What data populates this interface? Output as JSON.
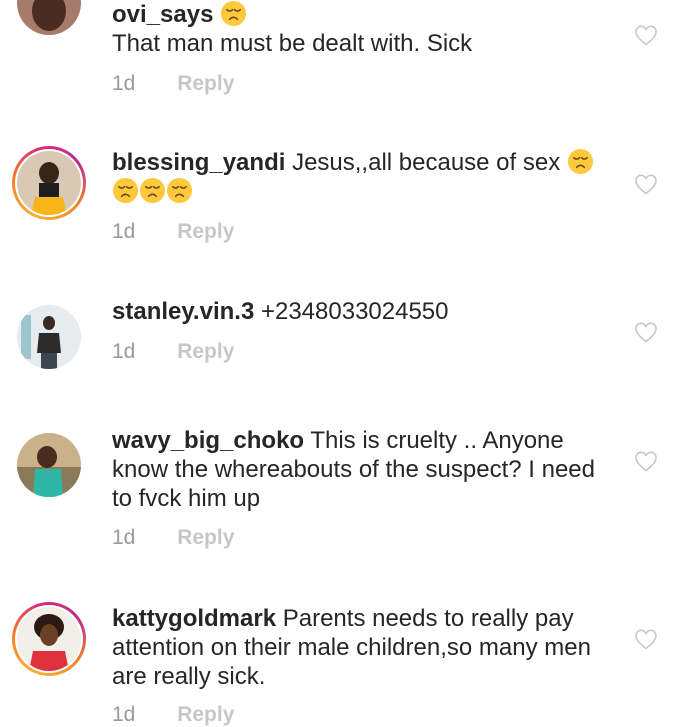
{
  "comments": [
    {
      "username": "ovi_says",
      "text": "That man must be dealt with. Sick",
      "time": "1d",
      "reply_label": "Reply",
      "emoji": "disappointed-face",
      "story_ring": false
    },
    {
      "username": "blessing_yandi",
      "text": "Jesus,,all because of sex",
      "time": "1d",
      "reply_label": "Reply",
      "emoji": "disappointed-face",
      "story_ring": true
    },
    {
      "username": "stanley.vin.3",
      "text": "+2348033024550",
      "time": "1d",
      "reply_label": "Reply",
      "story_ring": false
    },
    {
      "username": "wavy_big_choko",
      "text": "This is cruelty .. Anyone know the whereabouts of the suspect? I need to fvck him up",
      "time": "1d",
      "reply_label": "Reply",
      "story_ring": false
    },
    {
      "username": "kattygoldmark",
      "text": "Parents needs to really pay attention on their male children,so many men are really sick.",
      "time": "1d",
      "reply_label": "Reply",
      "story_ring": true
    }
  ],
  "icons": {
    "like": "heart-outline-icon",
    "emoji": "disappointed-face"
  },
  "colors": {
    "text": "#262626",
    "meta": "#9a9a9a",
    "reply": "#c7c7c7",
    "heart": "#c7c7c7",
    "story_ring_start": "#f9b13a",
    "story_ring_end": "#dd2a7b",
    "emoji_fill": "#ffc83d"
  }
}
